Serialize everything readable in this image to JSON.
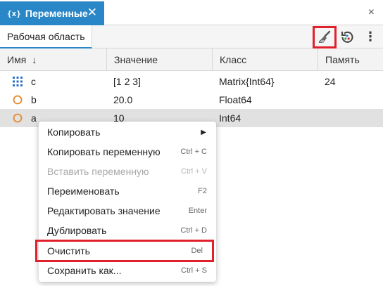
{
  "tab": {
    "icon_text": "{x}",
    "label": "Переменные",
    "close_glyph": "✕"
  },
  "window": {
    "close_glyph": "×"
  },
  "toolbar": {
    "workspace_tab": "Рабочая область",
    "more_glyph": "⋮"
  },
  "table": {
    "headers": {
      "name": "Имя",
      "sort_glyph": "↓",
      "value": "Значение",
      "class": "Класс",
      "memory": "Память"
    },
    "rows": [
      {
        "name": "c",
        "value": "[1 2 3]",
        "class": "Matrix{Int64}",
        "memory": "24",
        "icon": "matrix-icon"
      },
      {
        "name": "b",
        "value": "20.0",
        "class": "Float64",
        "memory": "",
        "icon": "scalar-icon"
      },
      {
        "name": "a",
        "value": "10",
        "class": "Int64",
        "memory": "",
        "icon": "scalar-icon"
      }
    ]
  },
  "context_menu": {
    "items": [
      {
        "label": "Копировать",
        "shortcut": "",
        "submenu": "▶"
      },
      {
        "label": "Копировать переменную",
        "shortcut": "Ctrl + C"
      },
      {
        "label": "Вставить переменную",
        "shortcut": "Ctrl + V"
      },
      {
        "label": "Переименовать",
        "shortcut": "F2"
      },
      {
        "label": "Редактировать значение",
        "shortcut": "Enter"
      },
      {
        "label": "Дублировать",
        "shortcut": "Ctrl + D"
      },
      {
        "label": "Очистить",
        "shortcut": "Del"
      },
      {
        "label": "Сохранить как...",
        "shortcut": "Ctrl + S"
      }
    ]
  },
  "colors": {
    "accent": "#2a87c7",
    "highlight": "#e0202c",
    "scalar_icon": "#e8892b",
    "matrix_icon": "#2a6fc7"
  }
}
